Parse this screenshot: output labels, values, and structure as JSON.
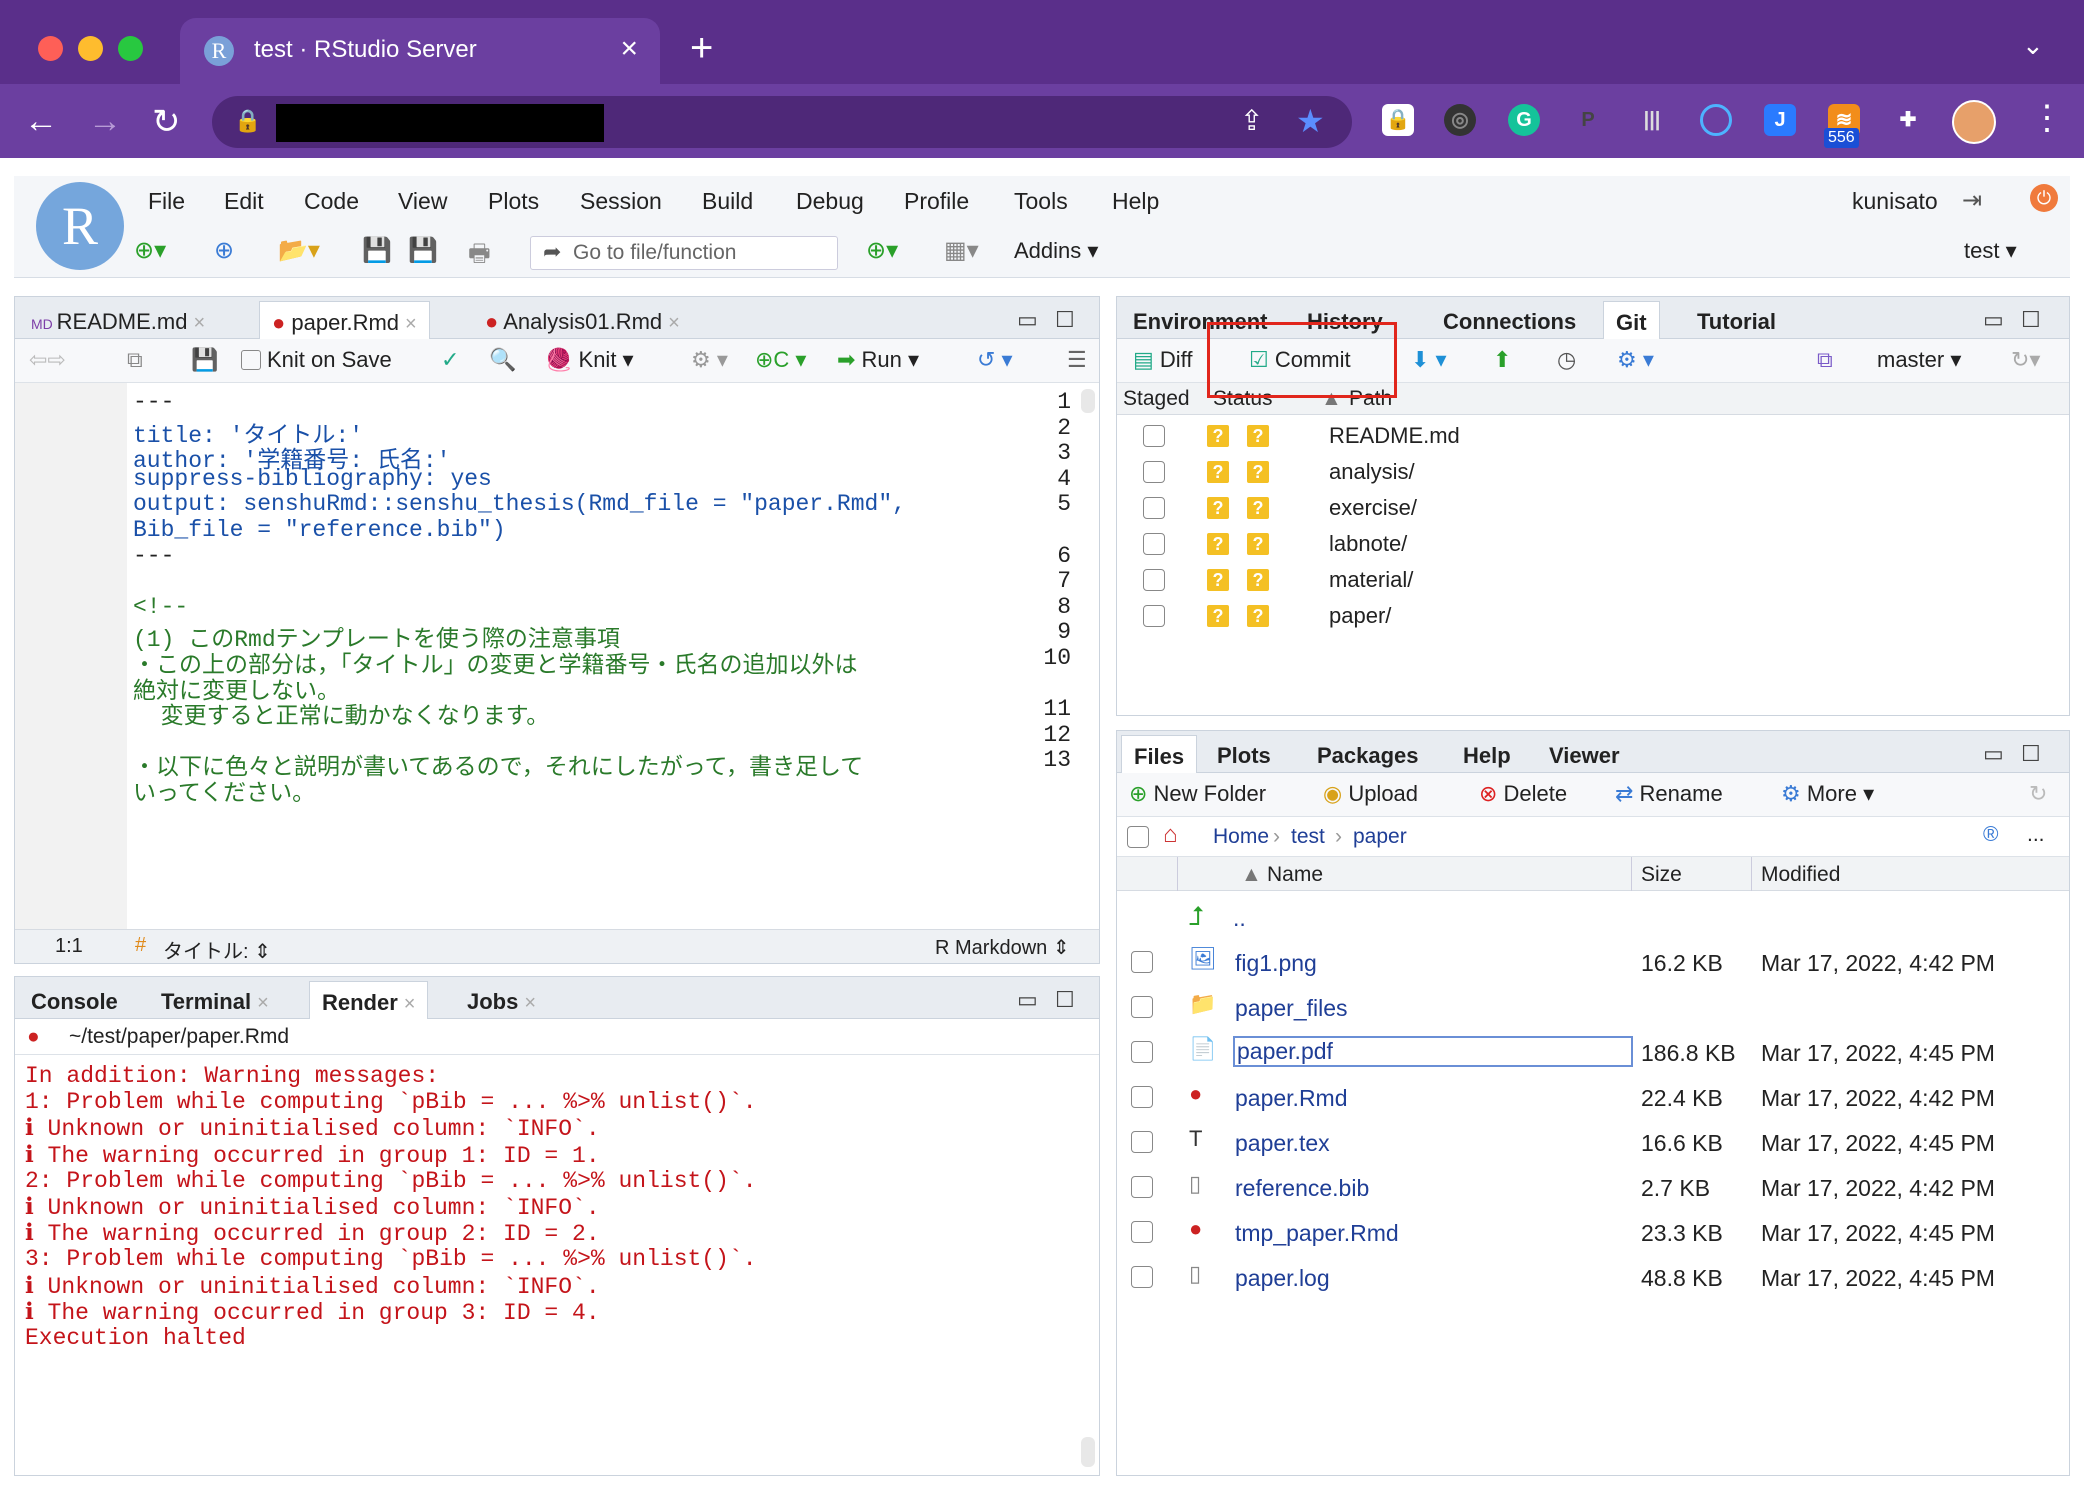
{
  "browser": {
    "tab_title": "test · RStudio Server",
    "tab_favicon": "R",
    "tab_close": "×",
    "new_tab": "+",
    "tab_menu": "⌄",
    "ext_badge": "556"
  },
  "menu": [
    "File",
    "Edit",
    "Code",
    "View",
    "Plots",
    "Session",
    "Build",
    "Debug",
    "Profile",
    "Tools",
    "Help"
  ],
  "user": "kunisato",
  "toolbar": {
    "goto_placeholder": "Go to file/function",
    "addins": "Addins ▾",
    "project": "test ▾"
  },
  "editor": {
    "tabs": [
      "README.md",
      "paper.Rmd",
      "Analysis01.Rmd"
    ],
    "tools": {
      "knit_on_save": "Knit on Save",
      "knit": "Knit",
      "run": "Run"
    },
    "lines": [
      {
        "n": "1",
        "text": "---"
      },
      {
        "n": "2",
        "text": "title: 'タイトル:'"
      },
      {
        "n": "3",
        "text": "author: '学籍番号: 氏名:'"
      },
      {
        "n": "4",
        "text": "suppress-bibliography: yes"
      },
      {
        "n": "5",
        "text": "output: senshuRmd::senshu_thesis(Rmd_file = \"paper.Rmd\","
      },
      {
        "n": "",
        "text": "Bib_file = \"reference.bib\")"
      },
      {
        "n": "6",
        "text": "---"
      },
      {
        "n": "7",
        "text": ""
      },
      {
        "n": "8",
        "text": "<!--"
      },
      {
        "n": "9",
        "text": "(1) このRmdテンプレートを使う際の注意事項"
      },
      {
        "n": "10",
        "text": "・この上の部分は，「タイトル」の変更と学籍番号・氏名の追加以外は"
      },
      {
        "n": "",
        "text": "絶対に変更しない。"
      },
      {
        "n": "11",
        "text": "  変更すると正常に動かなくなります。"
      },
      {
        "n": "12",
        "text": ""
      },
      {
        "n": "13",
        "text": "・以下に色々と説明が書いてあるので，それにしたがって，書き足して"
      },
      {
        "n": "",
        "text": "いってください。"
      }
    ],
    "status": {
      "pos": "1:1",
      "section": "タイトル: ⇕",
      "mode": "R Markdown ⇕"
    }
  },
  "console": {
    "tabs": [
      "Console",
      "Terminal",
      "Render",
      "Jobs"
    ],
    "path": "~/test/paper/paper.Rmd",
    "lines": [
      "In addition: Warning messages:",
      "1: Problem while computing `pBib = ... %>% unlist()`.",
      "ℹ Unknown or uninitialised column: `INFO`.",
      "ℹ The warning occurred in group 1: ID = 1.",
      "2: Problem while computing `pBib = ... %>% unlist()`.",
      "ℹ Unknown or uninitialised column: `INFO`.",
      "ℹ The warning occurred in group 2: ID = 2.",
      "3: Problem while computing `pBib = ... %>% unlist()`.",
      "ℹ Unknown or uninitialised column: `INFO`.",
      "ℹ The warning occurred in group 3: ID = 4.",
      "Execution halted"
    ]
  },
  "env_pane": {
    "tabs": [
      "Environment",
      "History",
      "Connections",
      "Git",
      "Tutorial"
    ],
    "diff": "Diff",
    "commit": "Commit",
    "branch": "master ▾",
    "headers": {
      "staged": "Staged",
      "status": "Status",
      "path": "Path"
    },
    "files": [
      "README.md",
      "analysis/",
      "exercise/",
      "labnote/",
      "material/",
      "paper/"
    ],
    "status_symbol": "?"
  },
  "files_pane": {
    "tabs": [
      "Files",
      "Plots",
      "Packages",
      "Help",
      "Viewer"
    ],
    "tools": {
      "new_folder": "New Folder",
      "upload": "Upload",
      "delete": "Delete",
      "rename": "Rename",
      "more": "More ▾"
    },
    "crumbs": [
      "Home",
      "test",
      "paper"
    ],
    "more_dots": "...",
    "headers": {
      "name": "Name",
      "size": "Size",
      "modified": "Modified"
    },
    "up": "..",
    "rows": [
      {
        "name": "fig1.png",
        "size": "16.2 KB",
        "modified": "Mar 17, 2022, 4:42 PM"
      },
      {
        "name": "paper_files",
        "size": "",
        "modified": ""
      },
      {
        "name": "paper.pdf",
        "size": "186.8 KB",
        "modified": "Mar 17, 2022, 4:45 PM"
      },
      {
        "name": "paper.Rmd",
        "size": "22.4 KB",
        "modified": "Mar 17, 2022, 4:42 PM"
      },
      {
        "name": "paper.tex",
        "size": "16.6 KB",
        "modified": "Mar 17, 2022, 4:45 PM"
      },
      {
        "name": "reference.bib",
        "size": "2.7 KB",
        "modified": "Mar 17, 2022, 4:42 PM"
      },
      {
        "name": "tmp_paper.Rmd",
        "size": "23.3 KB",
        "modified": "Mar 17, 2022, 4:45 PM"
      },
      {
        "name": "paper.log",
        "size": "48.8 KB",
        "modified": "Mar 17, 2022, 4:45 PM"
      }
    ]
  }
}
